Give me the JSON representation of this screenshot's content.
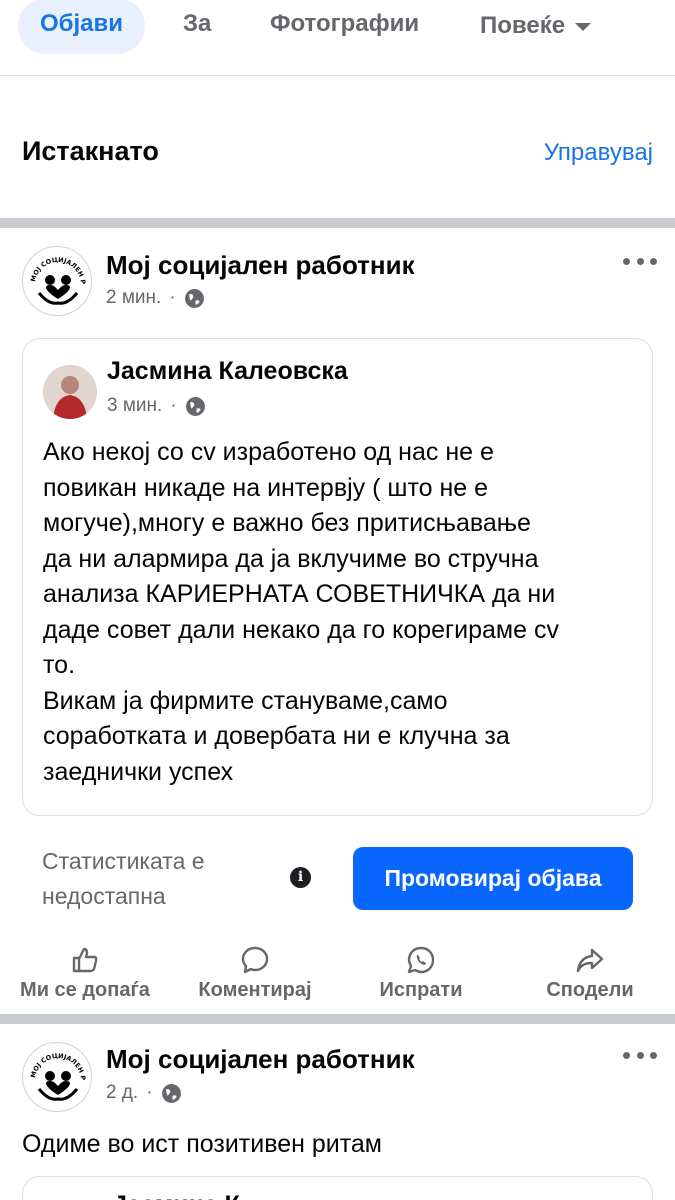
{
  "tabs": [
    {
      "label": "Објави",
      "active": true
    },
    {
      "label": "За"
    },
    {
      "label": "Фотографии"
    },
    {
      "label": "Повеќе"
    }
  ],
  "featured": {
    "title": "Истакнато",
    "manage": "Управувај"
  },
  "post1": {
    "page_name": "Мој социјален работник",
    "time": "2 мин.",
    "shared": {
      "author": "Јасмина Калеовска",
      "time": "3 мин.",
      "text": "Ако некој со cv изработено од нас не е\nповикан никаде на интервју ( што не е\nмогуче),многу е важно без притисњавање\nда ни алармира да ја вклучиме во стручна\nанализа КАРИЕРНАТА СОВЕТНИЧКА да ни\nдаде совет дали некако да го корегираме cv\nто.\nВикам ја фирмите станувамe,само\nсоработката и довербата ни е клучна за\nзаеднички успех"
    },
    "stats": "Статистиката е недостапна",
    "promote": "Промовирај објава"
  },
  "actions": {
    "like": "Ми се допаѓа",
    "comment": "Коментирај",
    "send": "Испрати",
    "share": "Сподели"
  },
  "post2": {
    "page_name": "Мој социјален работник",
    "time": "2 д.",
    "text": "Одиме во ист позитивен ритам",
    "peek": "Јасмина К"
  },
  "colors": {
    "accent": "#0866ff",
    "tab_active_bg": "#e7f0fc",
    "muted": "#65676b"
  }
}
